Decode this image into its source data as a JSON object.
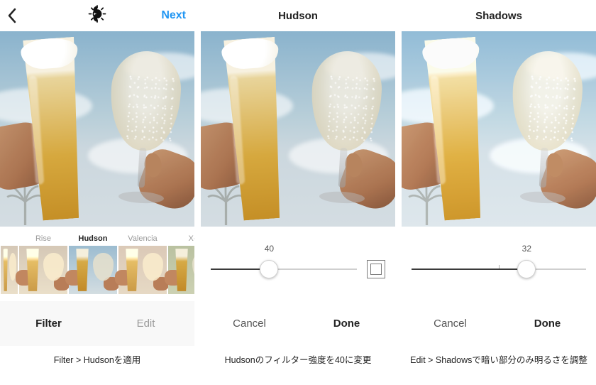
{
  "panels": [
    {
      "topbar": {
        "next": "Next"
      },
      "filters": [
        {
          "label": "Rise",
          "selected": false
        },
        {
          "label": "Hudson",
          "selected": true
        },
        {
          "label": "Valencia",
          "selected": false
        },
        {
          "label": "X-",
          "selected": false
        }
      ],
      "tabs": {
        "filter": "Filter",
        "edit": "Edit"
      },
      "caption": "Filter > Hudsonを適用"
    },
    {
      "title": "Hudson",
      "slider": {
        "value": 40,
        "min": 0,
        "max": 100,
        "percent": 40
      },
      "frame_toggle": true,
      "actions": {
        "cancel": "Cancel",
        "done": "Done"
      },
      "caption": "Hudsonのフィルター強度を40に変更"
    },
    {
      "title": "Shadows",
      "slider": {
        "value": 32,
        "min": -100,
        "max": 100,
        "percent": 66
      },
      "actions": {
        "cancel": "Cancel",
        "done": "Done"
      },
      "caption": "Edit > Shadowsで暗い部分のみ明るさを調整"
    }
  ]
}
